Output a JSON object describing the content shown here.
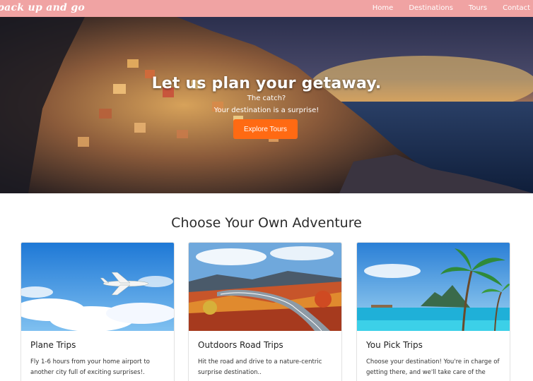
{
  "navbar": {
    "brand": "pack up and go",
    "links": [
      "Home",
      "Destinations",
      "Tours",
      "Contact"
    ]
  },
  "hero": {
    "title": "Let us plan your getaway.",
    "subtitle_1": "The catch?",
    "subtitle_2": "Your destination is a surprise!",
    "button_label": "Explore Tours"
  },
  "section": {
    "title": "Choose Your Own Adventure"
  },
  "cards": [
    {
      "title": "Plane Trips",
      "text": "Fly 1-6 hours from your home airport to another city full of exciting surprises!."
    },
    {
      "title": "Outdoors Road Trips",
      "text": "Hit the road and drive to a nature-centric surprise destination.."
    },
    {
      "title": "You Pick Trips",
      "text": "Choose your destination! You're in charge of getting there, and we'll take care of the"
    }
  ],
  "colors": {
    "navbar_bg": "#f0a3a3",
    "button_bg": "#ff6a13"
  }
}
